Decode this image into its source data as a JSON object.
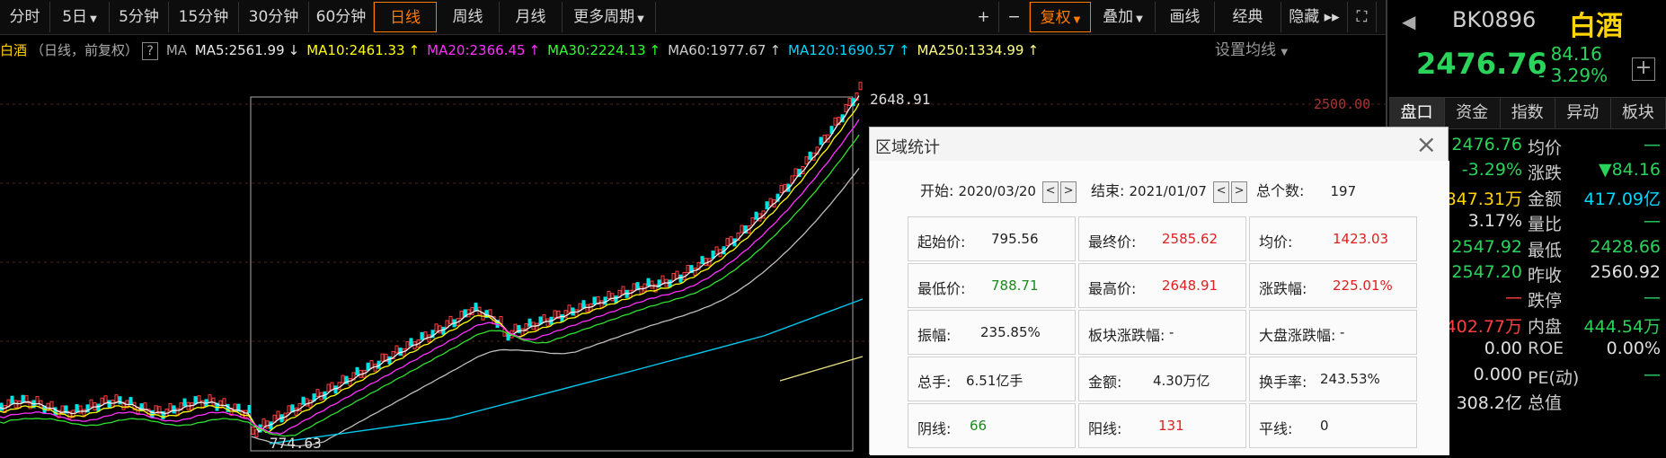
{
  "toolbar": {
    "periods": [
      {
        "label": "分时"
      },
      {
        "label": "5日",
        "caret": true
      },
      {
        "label": "5分钟"
      },
      {
        "label": "15分钟"
      },
      {
        "label": "30分钟"
      },
      {
        "label": "60分钟"
      },
      {
        "label": "日线",
        "active": true
      },
      {
        "label": "周线"
      },
      {
        "label": "月线"
      },
      {
        "label": "更多周期",
        "caret": true
      }
    ],
    "right": [
      {
        "label": "+"
      },
      {
        "label": "−"
      },
      {
        "label": "复权",
        "caret": true,
        "active": true
      },
      {
        "label": "叠加",
        "caret": true
      },
      {
        "label": "画线"
      },
      {
        "label": "经典"
      },
      {
        "label": "隐藏 ▸▸"
      },
      {
        "label": "⛶"
      }
    ]
  },
  "ma_bar": {
    "title": "白酒",
    "sub": "（日线，前复权）",
    "help": "?",
    "ma_label": "MA",
    "items": [
      {
        "text": "MA5:2561.99",
        "arrow": "↓",
        "color": "#e8e8e8"
      },
      {
        "text": "MA10:2461.33",
        "arrow": "↑",
        "color": "#ffff00"
      },
      {
        "text": "MA20:2366.45",
        "arrow": "↑",
        "color": "#ff30ff"
      },
      {
        "text": "MA30:2224.13",
        "arrow": "↑",
        "color": "#30ff30"
      },
      {
        "text": "MA60:1977.67",
        "arrow": "↑",
        "color": "#cfcfcf"
      },
      {
        "text": "MA120:1690.57",
        "arrow": "↑",
        "color": "#00d8ff"
      },
      {
        "text": "MA250:1334.99",
        "arrow": "↑",
        "color": "#ffff80"
      }
    ],
    "setting": "设置均线"
  },
  "chart": {
    "high_label": "2648.91",
    "low_label": "774.63",
    "axis_label": "2500.00"
  },
  "quote": {
    "code": "BK0896",
    "name": "白酒",
    "price": "2476.76",
    "change": "- 84.16",
    "pct": "- 3.29%",
    "tabs": [
      "盘口",
      "资金",
      "指数",
      "异动",
      "板块"
    ],
    "rows": [
      {
        "v1": "2476.76",
        "l2": "均价",
        "v2": "—",
        "c1": "#2ad45a",
        "c2": "#2ad45a"
      },
      {
        "v1": "-3.29%",
        "l2": "涨跌",
        "v2": "▼84.16",
        "c1": "#2ad45a",
        "c2": "#2ad45a"
      },
      {
        "v1": "847.31万",
        "l2": "金额",
        "v2": "417.09亿",
        "c1": "#ffd400",
        "c2": "#00d8ff"
      },
      {
        "v1": "3.17%",
        "l2": "量比",
        "v2": "—",
        "c1": "#e0e0e0",
        "c2": "#2ad45a"
      },
      {
        "v1": "2547.92",
        "l2": "最低",
        "v2": "2428.66",
        "c1": "#2ad45a",
        "c2": "#2ad45a"
      },
      {
        "v1": "2547.20",
        "l2": "昨收",
        "v2": "2560.92",
        "c1": "#2ad45a",
        "c2": "#e0e0e0"
      },
      {
        "v1": "—",
        "l2": "跌停",
        "v2": "—",
        "c1": "#ff4040",
        "c2": "#2ad45a"
      },
      {
        "v1": "402.77万",
        "l2": "内盘",
        "v2": "444.54万",
        "c1": "#ff4040",
        "c2": "#2ad45a"
      },
      {
        "v1": "0.00",
        "l2": "ROE",
        "v2": "0.00%",
        "c1": "#e0e0e0",
        "c2": "#e0e0e0"
      },
      {
        "v1": "0.000",
        "l2": "PE(动)",
        "v2": "—",
        "c1": "#e0e0e0",
        "c2": "#2ad45a"
      },
      {
        "v1": "308.2亿",
        "l2": "总值",
        "v2": "",
        "c1": "#e0e0e0",
        "c2": "#e0e0e0"
      }
    ]
  },
  "dialog": {
    "title": "区域统计",
    "start_label": "开始:",
    "start": "2020/03/20",
    "end_label": "结束:",
    "end": "2021/01/07",
    "count_label": "总个数:",
    "count": "197",
    "cells": [
      {
        "label": "起始价:",
        "value": "795.56",
        "cls": ""
      },
      {
        "label": "最终价:",
        "value": "2585.62",
        "cls": "red"
      },
      {
        "label": "均价:",
        "value": "1423.03",
        "cls": "red"
      },
      {
        "label": "最低价:",
        "value": "788.71",
        "cls": "green"
      },
      {
        "label": "最高价:",
        "value": "2648.91",
        "cls": "red"
      },
      {
        "label": "涨跌幅:",
        "value": "225.01%",
        "cls": "red"
      },
      {
        "label": "振幅:",
        "value": "235.85%",
        "cls": ""
      },
      {
        "label": "板块涨跌幅:",
        "value": "-",
        "cls": ""
      },
      {
        "label": "大盘涨跌幅:",
        "value": "-",
        "cls": ""
      },
      {
        "label": "总手:",
        "value": "6.51亿手",
        "cls": ""
      },
      {
        "label": "金额:",
        "value": "4.30万亿",
        "cls": ""
      },
      {
        "label": "换手率:",
        "value": "243.53%",
        "cls": ""
      },
      {
        "label": "阴线:",
        "value": "66",
        "cls": "green"
      },
      {
        "label": "阳线:",
        "value": "131",
        "cls": "red"
      },
      {
        "label": "平线:",
        "value": "0",
        "cls": ""
      }
    ]
  }
}
